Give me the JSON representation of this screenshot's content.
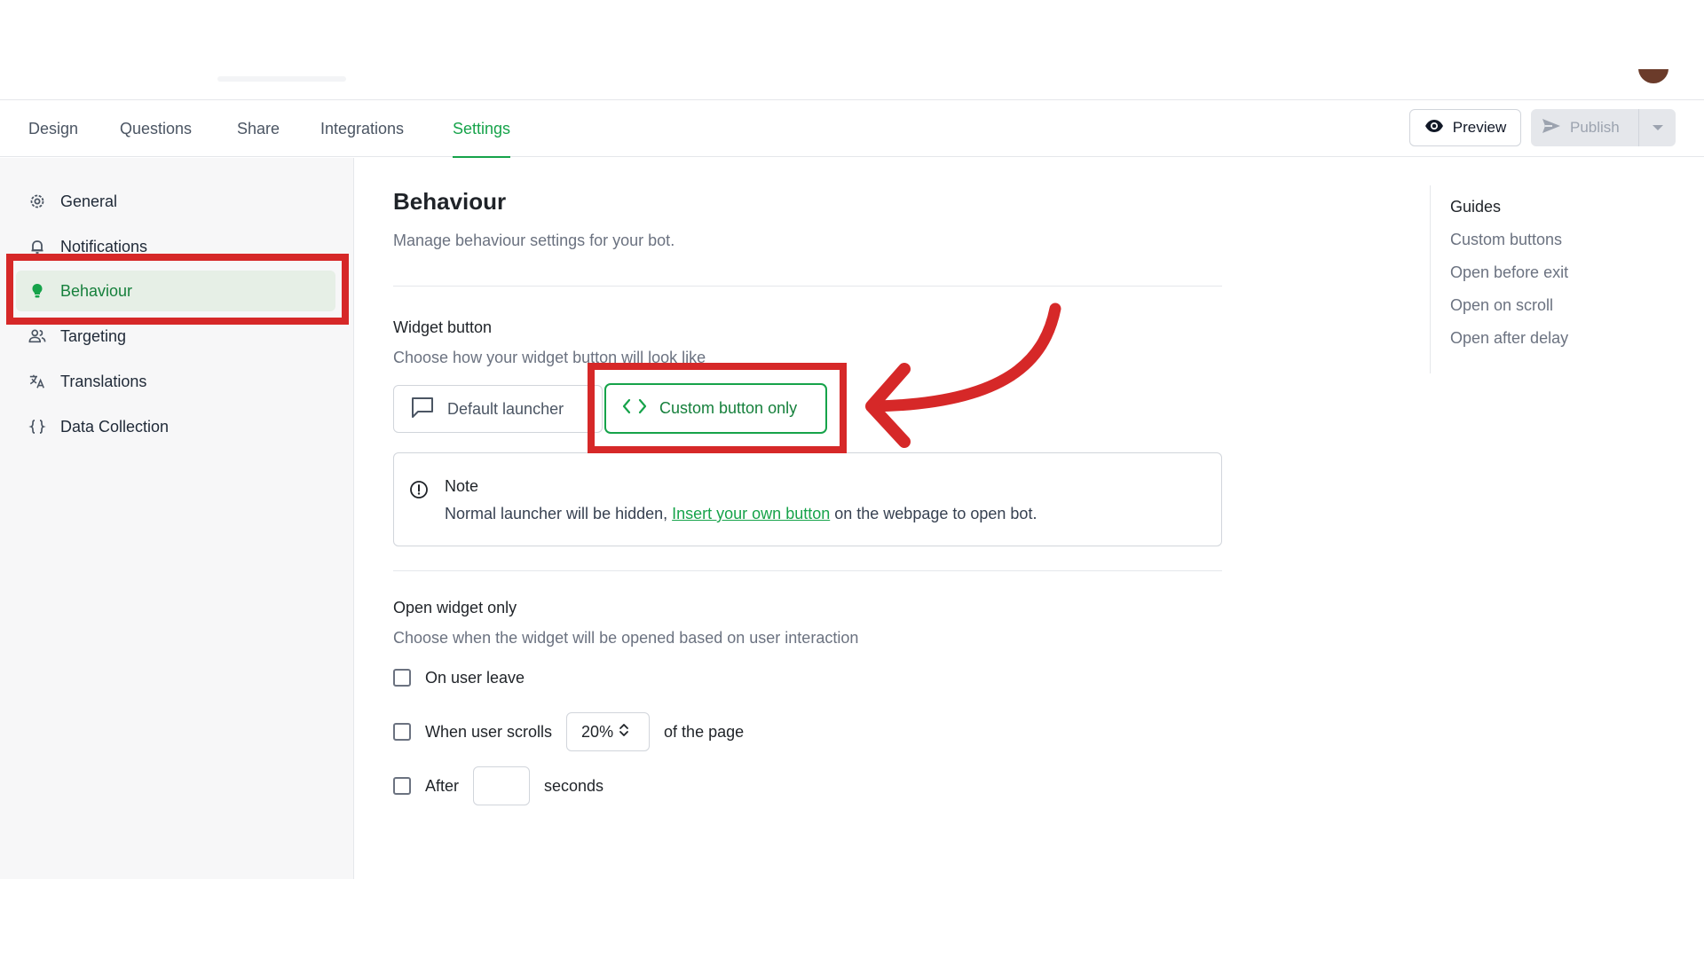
{
  "header": {
    "tabs": [
      {
        "label": "Design"
      },
      {
        "label": "Questions"
      },
      {
        "label": "Share"
      },
      {
        "label": "Integrations"
      },
      {
        "label": "Settings",
        "active": true
      }
    ],
    "preview_label": "Preview",
    "publish_label": "Publish"
  },
  "sidebar": {
    "items": [
      {
        "label": "General",
        "icon": "gear-icon"
      },
      {
        "label": "Notifications",
        "icon": "bell-icon"
      },
      {
        "label": "Behaviour",
        "icon": "bulb-icon",
        "active": true
      },
      {
        "label": "Targeting",
        "icon": "users-icon"
      },
      {
        "label": "Translations",
        "icon": "translate-icon"
      },
      {
        "label": "Data Collection",
        "icon": "braces-icon"
      }
    ]
  },
  "main": {
    "title": "Behaviour",
    "subtitle": "Manage behaviour settings for your bot.",
    "widget_button": {
      "title": "Widget button",
      "subtitle": "Choose how your widget button will look like",
      "option_default": "Default launcher",
      "option_custom": "Custom button only",
      "selected": "Custom button only"
    },
    "note": {
      "title": "Note",
      "text_before": "Normal launcher will be hidden, ",
      "link": "Insert your own button",
      "text_after": " on the webpage to open bot."
    },
    "open_widget": {
      "title": "Open widget only",
      "subtitle": "Choose when the widget will be opened based on user interaction",
      "on_leave": "On user leave",
      "when_scrolls": "When user scrolls",
      "scroll_value": "20%",
      "of_page": "of the page",
      "after": "After",
      "after_value": "",
      "seconds": "seconds"
    }
  },
  "guides": {
    "title": "Guides",
    "links": [
      "Custom buttons",
      "Open before exit",
      "Open on scroll",
      "Open after delay"
    ]
  },
  "colors": {
    "accent": "#16a34a",
    "annotation": "#d62828"
  }
}
